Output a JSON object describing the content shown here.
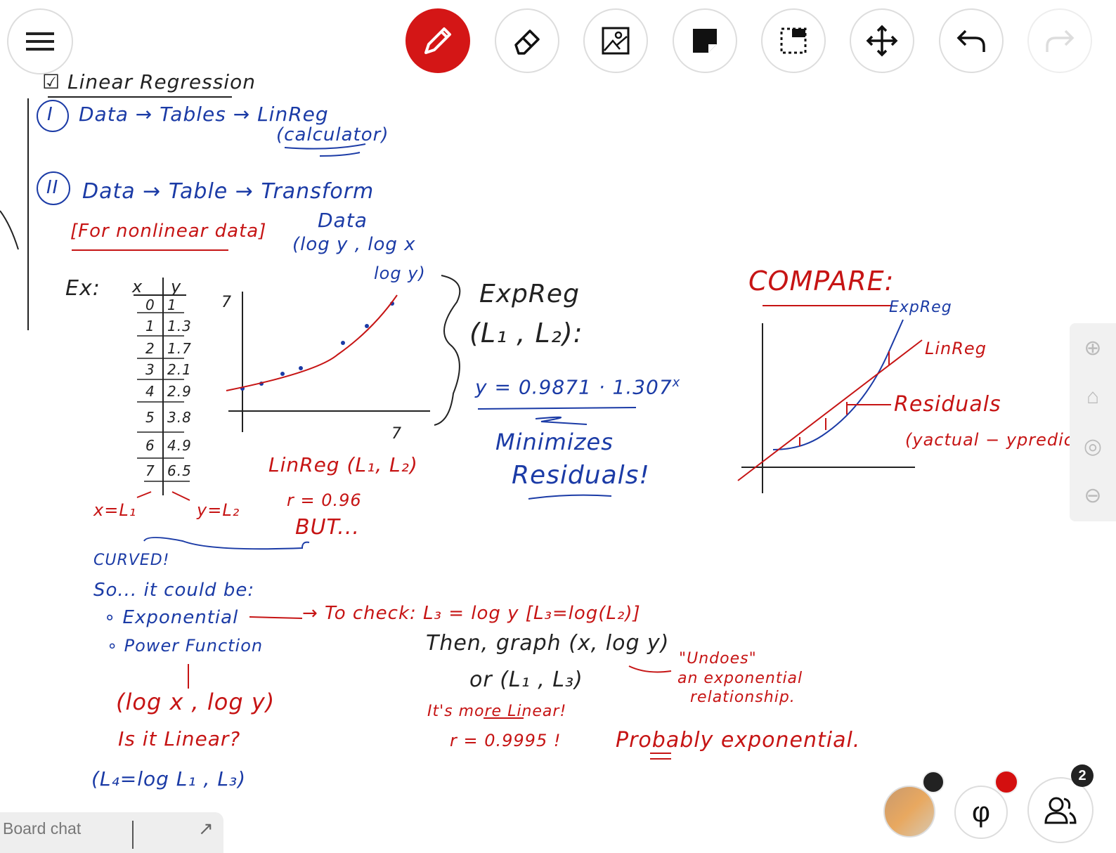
{
  "toolbar": {
    "menu": "menu-icon",
    "tools": [
      {
        "name": "pen",
        "icon": "pencil-icon",
        "active": true
      },
      {
        "name": "eraser",
        "icon": "eraser-icon"
      },
      {
        "name": "image",
        "icon": "image-icon"
      },
      {
        "name": "sticky-note",
        "icon": "sticky-note-icon"
      },
      {
        "name": "select",
        "icon": "selection-icon"
      },
      {
        "name": "move",
        "icon": "move-icon"
      },
      {
        "name": "undo",
        "icon": "undo-icon"
      },
      {
        "name": "redo",
        "icon": "redo-icon",
        "disabled": true
      }
    ],
    "accent": "#d41616"
  },
  "zoom_controls": [
    "zoom-in-icon",
    "home-icon",
    "zoom-reset-icon",
    "zoom-out-icon"
  ],
  "chat": {
    "label": "Board chat"
  },
  "footer": {
    "participants_count": "2",
    "formula_icon": "φ"
  },
  "notes": {
    "title": "Linear Regression",
    "item1": [
      "I",
      "Data → Tables → LinReg",
      "(calculator)"
    ],
    "item2": [
      "II",
      "Data → Table → Transform",
      "Data",
      "[For nonlinear data]",
      "(log y , log x",
      "log y)"
    ],
    "ex_label": "Ex:",
    "table_headers": [
      "x",
      "y"
    ],
    "table_x": [
      "0",
      "1",
      "2",
      "3",
      "4",
      "5",
      "6",
      "7"
    ],
    "table_y": [
      "1",
      "1.3",
      "1.7",
      "2.1",
      "2.9",
      "3.8",
      "4.9",
      "6.5"
    ],
    "xl": "x=L₁",
    "yl": "y=L₂",
    "graph_y_tick": "7",
    "graph_x_tick": "7",
    "linreg": "LinReg (L₁, L₂)",
    "r1": "r = 0.96",
    "but": "BUT...",
    "expreg": [
      "ExpReg",
      "(L₁ , L₂):"
    ],
    "eq": "y = 0.9871 · 1.307",
    "eq_exp": "x",
    "minimizes": [
      "Minimizes",
      "Residuals!"
    ],
    "compare": "COMPARE:",
    "cmp_exp": "ExpReg",
    "cmp_lin": "LinReg",
    "cmp_res": "Residuals",
    "cmp_res2": "(yactual − ypredicted",
    "curved": "CURVED!",
    "could": "So... it could be:",
    "opts": [
      "∘ Exponential",
      "∘ Power Function"
    ],
    "tocheck": "→ To check: L₃ = log y [L₃=log(L₂)]",
    "then": "Then, graph (x, log y)",
    "or": "or (L₁ , L₃)",
    "undoes": [
      "\"Undoes\"",
      "an exponential",
      "relationship."
    ],
    "logxy": "(log x , log y)",
    "islinear": "Is it Linear?",
    "l4": "(L₄=log L₁ , L₃)",
    "morelinear": "It's more Linear!",
    "r2": "r = 0.9995 !",
    "probably": "Probably exponential."
  }
}
